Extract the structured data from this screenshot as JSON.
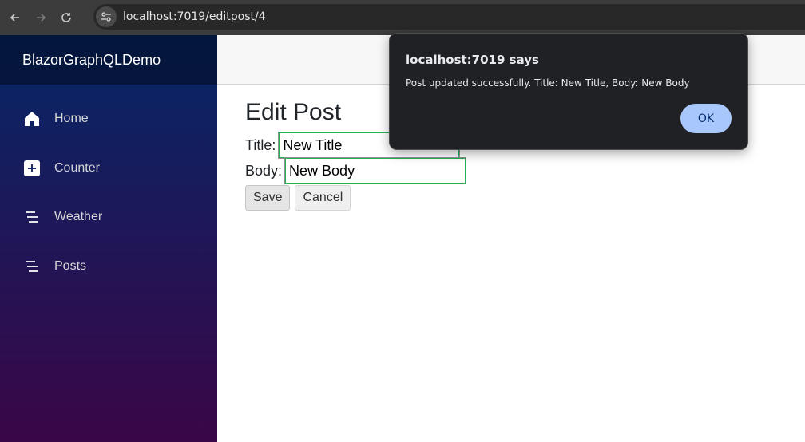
{
  "browser": {
    "url": "localhost:7019/editpost/4"
  },
  "sidebar": {
    "brand": "BlazorGraphQLDemo",
    "items": [
      {
        "label": "Home",
        "icon": "home-icon"
      },
      {
        "label": "Counter",
        "icon": "plus-square-icon"
      },
      {
        "label": "Weather",
        "icon": "list-icon"
      },
      {
        "label": "Posts",
        "icon": "list-icon"
      }
    ]
  },
  "main": {
    "title": "Edit Post",
    "title_label": "Title:",
    "title_value": "New Title",
    "body_label": "Body:",
    "body_value": "New Body",
    "save_label": "Save",
    "cancel_label": "Cancel"
  },
  "dialog": {
    "title": "localhost:7019 says",
    "message": "Post updated successfully. Title: New Title, Body: New Body",
    "ok_label": "OK"
  },
  "colors": {
    "sidebar_top": "#052767",
    "sidebar_bottom": "#3a0647",
    "dialog_bg": "#202124",
    "ok_button": "#a8c7fa"
  }
}
